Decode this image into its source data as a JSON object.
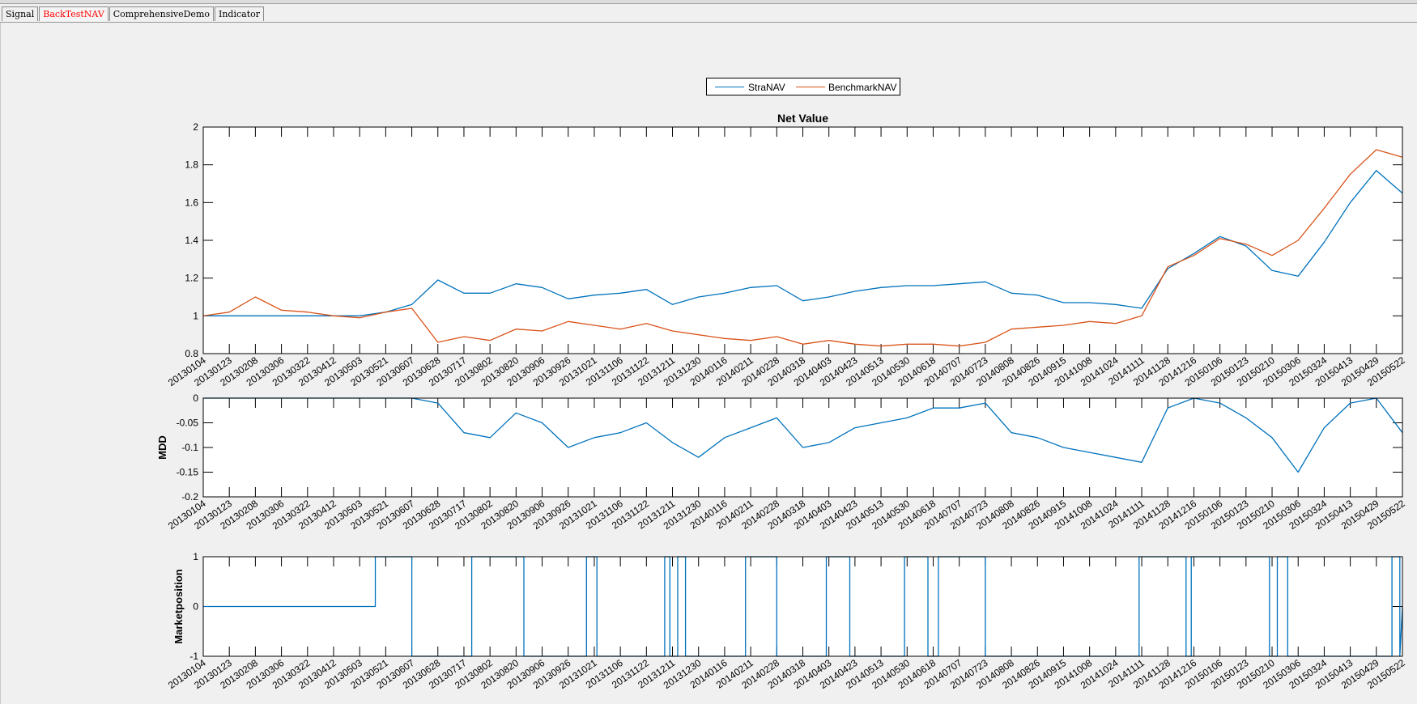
{
  "tabs": [
    {
      "label": "Signal",
      "active": false
    },
    {
      "label": "BackTestNAV",
      "active": true
    },
    {
      "label": "ComprehensiveDemo",
      "active": false
    },
    {
      "label": "Indicator",
      "active": false
    }
  ],
  "colors": {
    "strategy": "#0072bd",
    "benchmark": "#d95319",
    "axis": "#000000",
    "active_tab": "#ff0000"
  },
  "legend": {
    "entries": [
      {
        "name": "StraNAV",
        "color": "#0072bd"
      },
      {
        "name": "BenchmarkNAV",
        "color": "#d95319"
      }
    ]
  },
  "x_tick_labels": [
    "20130104",
    "20130123",
    "20130208",
    "20130306",
    "20130322",
    "20130412",
    "20130503",
    "20130521",
    "20130607",
    "20130628",
    "20130717",
    "20130802",
    "20130820",
    "20130906",
    "20130926",
    "20131021",
    "20131106",
    "20131122",
    "20131211",
    "20131230",
    "20140116",
    "20140211",
    "20140228",
    "20140318",
    "20140403",
    "20140423",
    "20140513",
    "20140530",
    "20140618",
    "20140707",
    "20140723",
    "20140808",
    "20140826",
    "20140915",
    "20141008",
    "20141024",
    "20141111",
    "20141128",
    "20141216",
    "20150106",
    "20150123",
    "20150210",
    "20150306",
    "20150324",
    "20150413",
    "20150429",
    "20150522"
  ],
  "chart_data": [
    {
      "type": "line",
      "title": "Net Value",
      "xlabel": "",
      "ylabel": "",
      "ylim": [
        0.8,
        2
      ],
      "yticks": [
        "0.8",
        "1",
        "1.2",
        "1.4",
        "1.6",
        "1.8",
        "2"
      ],
      "x_index_range": [
        0,
        46
      ],
      "legend_position": "top-center",
      "series": [
        {
          "name": "StraNAV",
          "color": "#0072bd",
          "x": [
            0,
            1,
            2,
            3,
            4,
            5,
            6,
            7,
            8,
            9,
            10,
            11,
            12,
            13,
            14,
            15,
            16,
            17,
            18,
            19,
            20,
            21,
            22,
            23,
            24,
            25,
            26,
            27,
            28,
            29,
            30,
            31,
            32,
            33,
            34,
            35,
            36,
            37,
            38,
            39,
            40,
            41,
            42,
            43,
            44,
            45,
            46
          ],
          "y": [
            1.0,
            1.0,
            1.0,
            1.0,
            1.0,
            1.0,
            1.0,
            1.02,
            1.06,
            1.19,
            1.12,
            1.12,
            1.17,
            1.15,
            1.09,
            1.11,
            1.12,
            1.14,
            1.06,
            1.1,
            1.12,
            1.15,
            1.16,
            1.08,
            1.1,
            1.13,
            1.15,
            1.16,
            1.16,
            1.17,
            1.18,
            1.12,
            1.11,
            1.07,
            1.07,
            1.06,
            1.04,
            1.25,
            1.33,
            1.42,
            1.37,
            1.24,
            1.21,
            1.39,
            1.6,
            1.77,
            1.65
          ]
        },
        {
          "name": "BenchmarkNAV",
          "color": "#d95319",
          "x": [
            0,
            1,
            2,
            3,
            4,
            5,
            6,
            7,
            8,
            9,
            10,
            11,
            12,
            13,
            14,
            15,
            16,
            17,
            18,
            19,
            20,
            21,
            22,
            23,
            24,
            25,
            26,
            27,
            28,
            29,
            30,
            31,
            32,
            33,
            34,
            35,
            36,
            37,
            38,
            39,
            40,
            41,
            42,
            43,
            44,
            45,
            46
          ],
          "y": [
            1.0,
            1.02,
            1.1,
            1.03,
            1.02,
            1.0,
            0.99,
            1.02,
            1.04,
            0.86,
            0.89,
            0.87,
            0.93,
            0.92,
            0.97,
            0.95,
            0.93,
            0.96,
            0.92,
            0.9,
            0.88,
            0.87,
            0.89,
            0.85,
            0.87,
            0.85,
            0.84,
            0.85,
            0.85,
            0.84,
            0.86,
            0.93,
            0.94,
            0.95,
            0.97,
            0.96,
            1.0,
            1.26,
            1.32,
            1.41,
            1.38,
            1.32,
            1.4,
            1.57,
            1.75,
            1.88,
            1.84
          ]
        }
      ]
    },
    {
      "type": "line",
      "title": "",
      "xlabel": "",
      "ylabel": "MDD",
      "ylim": [
        -0.2,
        0
      ],
      "yticks": [
        "-0.2",
        "-0.15",
        "-0.1",
        "-0.05",
        "0"
      ],
      "x_index_range": [
        0,
        46
      ],
      "series": [
        {
          "color": "#0072bd",
          "x": [
            0,
            1,
            2,
            3,
            4,
            5,
            6,
            7,
            8,
            9,
            10,
            11,
            12,
            13,
            14,
            15,
            16,
            17,
            18,
            19,
            20,
            21,
            22,
            23,
            24,
            25,
            26,
            27,
            28,
            29,
            30,
            31,
            32,
            33,
            34,
            35,
            36,
            37,
            38,
            39,
            40,
            41,
            42,
            43,
            44,
            45,
            46
          ],
          "y": [
            0,
            0,
            0,
            0,
            0,
            0,
            0,
            0,
            0,
            -0.01,
            -0.07,
            -0.08,
            -0.03,
            -0.05,
            -0.1,
            -0.08,
            -0.07,
            -0.05,
            -0.09,
            -0.12,
            -0.08,
            -0.06,
            -0.04,
            -0.1,
            -0.09,
            -0.06,
            -0.05,
            -0.04,
            -0.02,
            -0.02,
            -0.01,
            -0.07,
            -0.08,
            -0.1,
            -0.11,
            -0.12,
            -0.13,
            -0.02,
            0,
            -0.01,
            -0.04,
            -0.08,
            -0.15,
            -0.06,
            -0.01,
            0,
            -0.07
          ]
        }
      ]
    },
    {
      "type": "line",
      "title": "",
      "xlabel": "",
      "ylabel": "Marketposition",
      "ylim": [
        -1,
        1
      ],
      "yticks": [
        "-1",
        "0",
        "1"
      ],
      "x_index_range": [
        0,
        46
      ],
      "series": [
        {
          "color": "#0072bd",
          "x": [
            0,
            6.6,
            6.6,
            8,
            8,
            10.3,
            10.3,
            12.3,
            12.3,
            14.7,
            14.7,
            15.1,
            15.1,
            17.7,
            17.7,
            17.9,
            17.9,
            18.2,
            18.2,
            18.5,
            18.5,
            20.8,
            20.8,
            22,
            22,
            23.9,
            23.9,
            24.8,
            24.8,
            26.9,
            26.9,
            27.8,
            27.8,
            28.2,
            28.2,
            30,
            30,
            35.9,
            35.9,
            37.7,
            37.7,
            37.9,
            37.9,
            40.9,
            40.9,
            41.2,
            41.2,
            41.6,
            41.6,
            45.6,
            45.6,
            45.9,
            45.9,
            46
          ],
          "y": [
            0,
            0,
            1,
            1,
            -1,
            -1,
            1,
            1,
            -1,
            -1,
            1,
            1,
            -1,
            -1,
            1,
            1,
            -1,
            -1,
            1,
            1,
            -1,
            -1,
            1,
            1,
            -1,
            -1,
            1,
            1,
            -1,
            -1,
            1,
            1,
            -1,
            -1,
            1,
            1,
            -1,
            -1,
            1,
            1,
            -1,
            -1,
            1,
            1,
            -1,
            -1,
            1,
            1,
            -1,
            -1,
            1,
            1,
            -1,
            0
          ]
        }
      ]
    }
  ]
}
